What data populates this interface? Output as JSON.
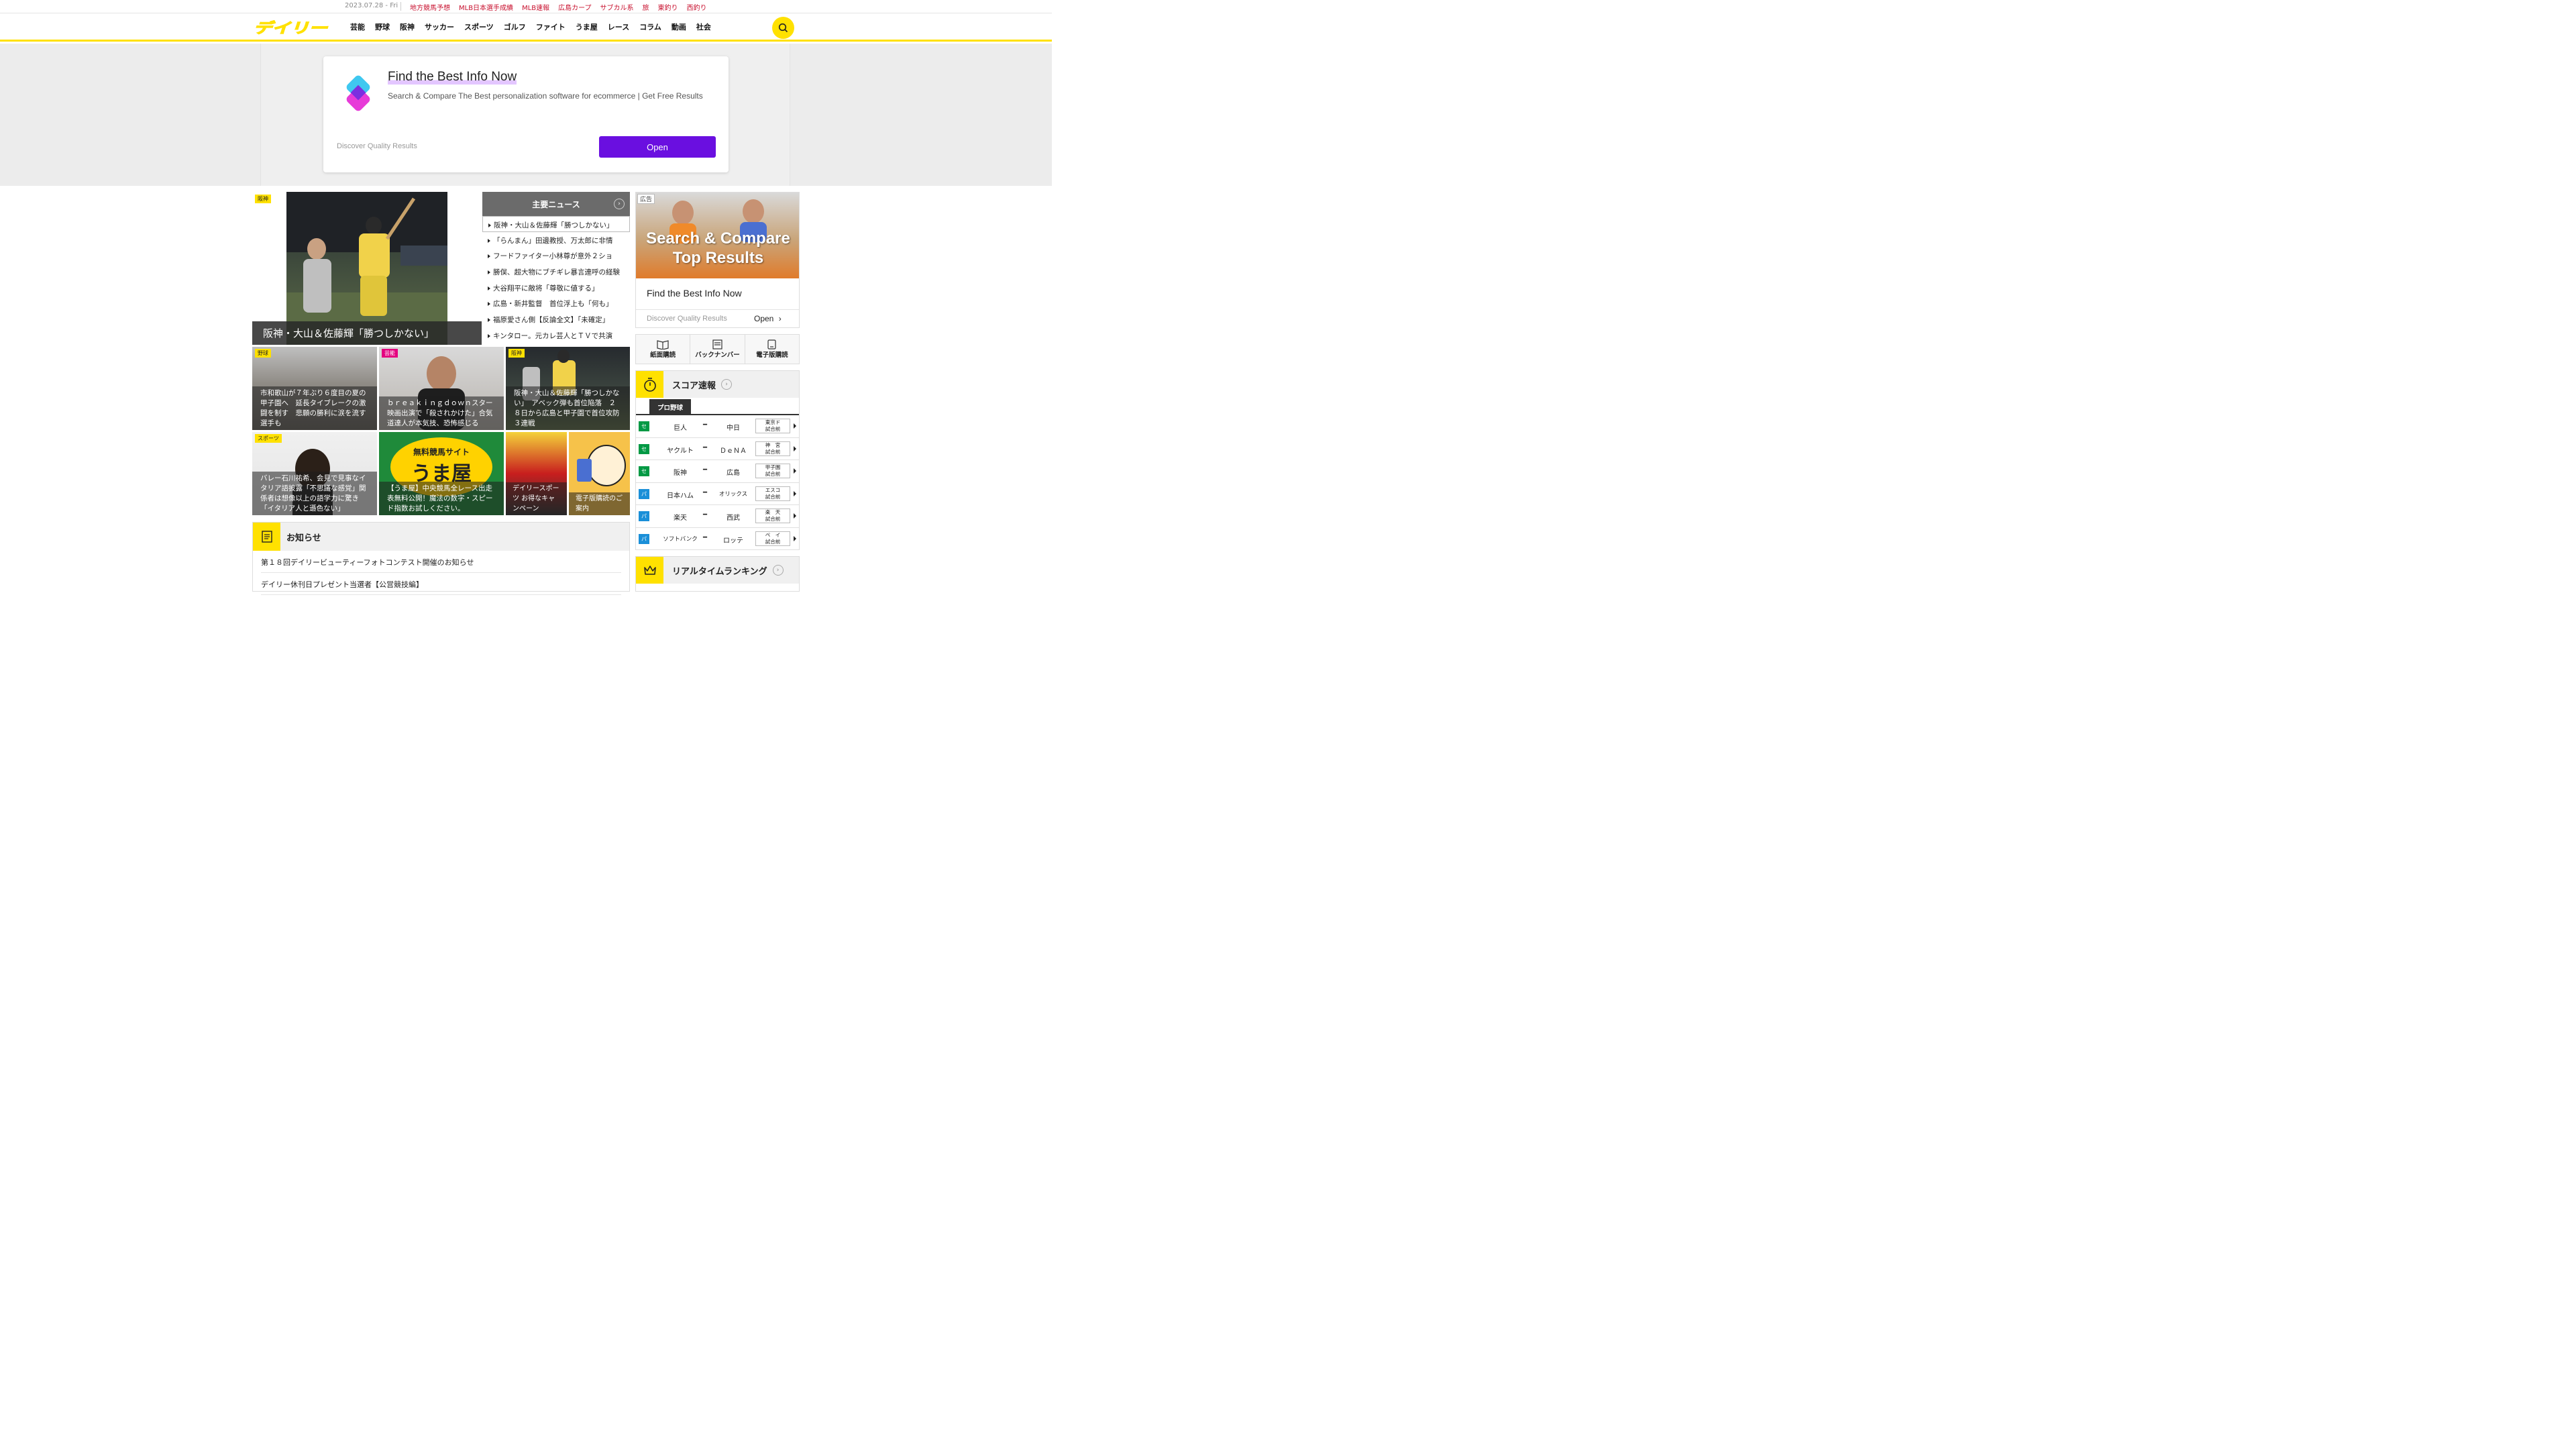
{
  "topbar": {
    "date": "2023.07.28 - Fri",
    "links": [
      "地方競馬予想",
      "MLB日本選手成績",
      "MLB速報",
      "広島カープ",
      "サブカル系",
      "旅",
      "東釣り",
      "西釣り"
    ]
  },
  "header": {
    "logo_text": "デイリー",
    "nav": [
      "芸能",
      "野球",
      "阪神",
      "サッカー",
      "スポーツ",
      "ゴルフ",
      "ファイト",
      "うま屋",
      "レース",
      "コラム",
      "動画",
      "社会"
    ]
  },
  "top_ad": {
    "title": "Find the Best Info Now",
    "description": "Search & Compare The Best personalization software for ecommerce | Get Free Results",
    "disclaimer": "Discover Quality Results",
    "button": "Open"
  },
  "hero": {
    "tag": "阪神",
    "caption": "阪神・大山＆佐藤輝「勝つしかない」"
  },
  "main_news": {
    "title": "主要ニュース",
    "items": [
      "阪神・大山＆佐藤輝「勝つしかない」",
      "「らんまん」田邊教授、万太郎に非情",
      "フードファイター小林尊が意外２ショ",
      "勝俣、超大物にブチギレ暴言連呼の経験",
      "大谷翔平に敵将「尊敬に値する」",
      "広島・新井監督　首位浮上も「何も」",
      "福原愛さん側【反論全文】「未確定」",
      "キンタロー。元カレ芸人とＴＶで共演"
    ]
  },
  "tiles": [
    {
      "tag": "野球",
      "caption": "市和歌山が７年ぶり６度目の夏の甲子園へ　延長タイブレークの激闘を制す　悲願の勝利に涙を流す選手も"
    },
    {
      "tag": "芸能",
      "caption": "ｂｒｅａｋｉｎｇｄｏｗｎスター映画出演で「殺されかけた」合気道達人が本気技、恐怖感じる"
    },
    {
      "tag": "阪神",
      "caption": "阪神・大山＆佐藤輝「勝つしかない」　アベック弾も首位陥落　２８日から広島と甲子園で首位攻防３連戦"
    },
    {
      "tag": "スポーツ",
      "caption": "バレー石川祐希、会見で見事なイタリア語披露「不思議な感覚」関係者は想像以上の語学力に驚き「イタリア人と遜色ない」"
    },
    {
      "tag": "",
      "caption": "【うま屋】中央競馬全レース出走表無料公開！魔法の数字・スピード指数お試しください。"
    },
    {
      "tag": "",
      "caption": "デイリースポーツ お得なキャンペーン"
    },
    {
      "tag": "",
      "caption": "電子版購読のご案内"
    }
  ],
  "tile_badges": {
    "uma_top": "無料競馬サイト",
    "uma_main": "うま屋"
  },
  "notice": {
    "title": "お知らせ",
    "items": [
      "第１８回デイリービューティーフォトコンテスト開催のお知らせ",
      "デイリー休刊日プレゼント当選者【公営競技編】"
    ]
  },
  "right_ad": {
    "tag": "広告",
    "headline": "Search & Compare Top Results",
    "title": "Find the Best Info Now",
    "disclaimer": "Discover Quality Results",
    "button": "Open"
  },
  "subscribe": [
    "紙面購読",
    "バックナンバー",
    "電子版購読"
  ],
  "score": {
    "title": "スコア速報",
    "tab": "プロ野球",
    "games": [
      {
        "league": "セ",
        "home": "巨人",
        "away": "中日",
        "venue": "東京ド",
        "status": "試合前"
      },
      {
        "league": "セ",
        "home": "ヤクルト",
        "away": "ＤｅＮＡ",
        "venue": "神　宮",
        "status": "試合前"
      },
      {
        "league": "セ",
        "home": "阪神",
        "away": "広島",
        "venue": "甲子園",
        "status": "試合前"
      },
      {
        "league": "パ",
        "home": "日本ハム",
        "away": "オリックス",
        "venue": "エスコ",
        "status": "試合前"
      },
      {
        "league": "パ",
        "home": "楽天",
        "away": "西武",
        "venue": "楽　天",
        "status": "試合前"
      },
      {
        "league": "パ",
        "home": "ソフトバンク",
        "away": "ロッテ",
        "venue": "ペ　イ",
        "status": "試合前"
      }
    ]
  },
  "ranking": {
    "title": "リアルタイムランキング"
  },
  "colors": {
    "brand_yellow": "#ffe100",
    "accent_red": "#c8102e",
    "ad_purple": "#6a0fe0",
    "central_league": "#009944",
    "pacific_league": "#1a8fd8"
  }
}
